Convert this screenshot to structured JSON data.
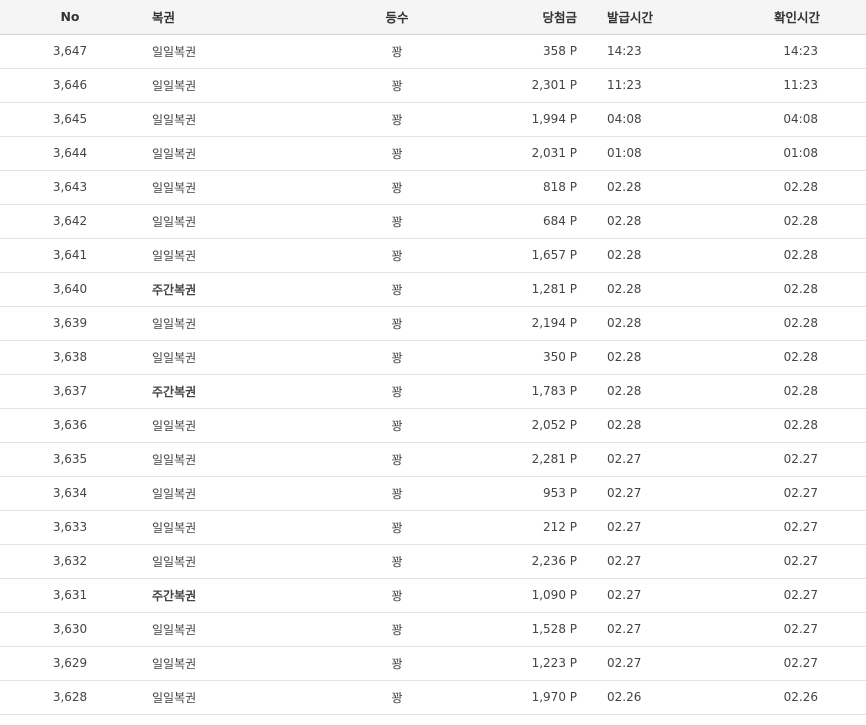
{
  "headers": {
    "no": "No",
    "type": "복권",
    "rank": "등수",
    "prize": "당첨금",
    "issued": "발급시간",
    "checked": "확인시간"
  },
  "rows": [
    {
      "no": "3,647",
      "type": "일일복권",
      "bold": false,
      "rank": "꽝",
      "prize": "358 P",
      "issued": "14:23",
      "checked": "14:23"
    },
    {
      "no": "3,646",
      "type": "일일복권",
      "bold": false,
      "rank": "꽝",
      "prize": "2,301 P",
      "issued": "11:23",
      "checked": "11:23"
    },
    {
      "no": "3,645",
      "type": "일일복권",
      "bold": false,
      "rank": "꽝",
      "prize": "1,994 P",
      "issued": "04:08",
      "checked": "04:08"
    },
    {
      "no": "3,644",
      "type": "일일복권",
      "bold": false,
      "rank": "꽝",
      "prize": "2,031 P",
      "issued": "01:08",
      "checked": "01:08"
    },
    {
      "no": "3,643",
      "type": "일일복권",
      "bold": false,
      "rank": "꽝",
      "prize": "818 P",
      "issued": "02.28",
      "checked": "02.28"
    },
    {
      "no": "3,642",
      "type": "일일복권",
      "bold": false,
      "rank": "꽝",
      "prize": "684 P",
      "issued": "02.28",
      "checked": "02.28"
    },
    {
      "no": "3,641",
      "type": "일일복권",
      "bold": false,
      "rank": "꽝",
      "prize": "1,657 P",
      "issued": "02.28",
      "checked": "02.28"
    },
    {
      "no": "3,640",
      "type": "주간복권",
      "bold": true,
      "rank": "꽝",
      "prize": "1,281 P",
      "issued": "02.28",
      "checked": "02.28"
    },
    {
      "no": "3,639",
      "type": "일일복권",
      "bold": false,
      "rank": "꽝",
      "prize": "2,194 P",
      "issued": "02.28",
      "checked": "02.28"
    },
    {
      "no": "3,638",
      "type": "일일복권",
      "bold": false,
      "rank": "꽝",
      "prize": "350 P",
      "issued": "02.28",
      "checked": "02.28"
    },
    {
      "no": "3,637",
      "type": "주간복권",
      "bold": true,
      "rank": "꽝",
      "prize": "1,783 P",
      "issued": "02.28",
      "checked": "02.28"
    },
    {
      "no": "3,636",
      "type": "일일복권",
      "bold": false,
      "rank": "꽝",
      "prize": "2,052 P",
      "issued": "02.28",
      "checked": "02.28"
    },
    {
      "no": "3,635",
      "type": "일일복권",
      "bold": false,
      "rank": "꽝",
      "prize": "2,281 P",
      "issued": "02.27",
      "checked": "02.27"
    },
    {
      "no": "3,634",
      "type": "일일복권",
      "bold": false,
      "rank": "꽝",
      "prize": "953 P",
      "issued": "02.27",
      "checked": "02.27"
    },
    {
      "no": "3,633",
      "type": "일일복권",
      "bold": false,
      "rank": "꽝",
      "prize": "212 P",
      "issued": "02.27",
      "checked": "02.27"
    },
    {
      "no": "3,632",
      "type": "일일복권",
      "bold": false,
      "rank": "꽝",
      "prize": "2,236 P",
      "issued": "02.27",
      "checked": "02.27"
    },
    {
      "no": "3,631",
      "type": "주간복권",
      "bold": true,
      "rank": "꽝",
      "prize": "1,090 P",
      "issued": "02.27",
      "checked": "02.27"
    },
    {
      "no": "3,630",
      "type": "일일복권",
      "bold": false,
      "rank": "꽝",
      "prize": "1,528 P",
      "issued": "02.27",
      "checked": "02.27"
    },
    {
      "no": "3,629",
      "type": "일일복권",
      "bold": false,
      "rank": "꽝",
      "prize": "1,223 P",
      "issued": "02.27",
      "checked": "02.27"
    },
    {
      "no": "3,628",
      "type": "일일복권",
      "bold": false,
      "rank": "꽝",
      "prize": "1,970 P",
      "issued": "02.26",
      "checked": "02.26"
    }
  ]
}
